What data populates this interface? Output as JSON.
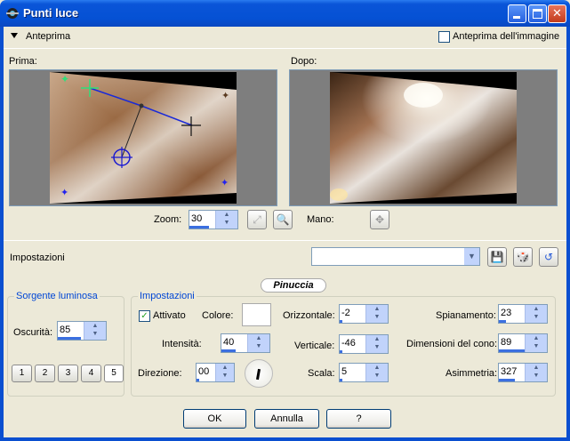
{
  "window": {
    "title": "Punti luce"
  },
  "preview": {
    "section_label": "Anteprima",
    "image_preview_label": "Anteprima dell'immagine",
    "before_label": "Prima:",
    "after_label": "Dopo:",
    "zoom_label": "Zoom:",
    "zoom_value": "30",
    "pan_label": "Mano:"
  },
  "presets": {
    "label": "Impostazioni",
    "selected": ""
  },
  "watermark": "Pinuccia",
  "light_source": {
    "group_title": "Sorgente luminosa",
    "darkness_label": "Oscurità:",
    "darkness_value": "85",
    "light_tabs": [
      "1",
      "2",
      "3",
      "4",
      "5"
    ]
  },
  "settings": {
    "group_title": "Impostazioni",
    "enabled_label": "Attivato",
    "enabled": true,
    "color_label": "Colore:",
    "color_value": "#FFFFFF",
    "intensity_label": "Intensità:",
    "intensity_value": "40",
    "direction_label": "Direzione:",
    "direction_value": "00",
    "horizontal_label": "Orizzontale:",
    "horizontal_value": "-2",
    "vertical_label": "Verticale:",
    "vertical_value": "-46",
    "scale_label": "Scala:",
    "scale_value": "5",
    "smoothing_label": "Spianamento:",
    "smoothing_value": "23",
    "cone_label": "Dimensioni del cono:",
    "cone_value": "89",
    "asymmetry_label": "Asimmetria:",
    "asymmetry_value": "327"
  },
  "buttons": {
    "ok": "OK",
    "cancel": "Annulla",
    "help": "?"
  },
  "colors": {
    "title_bar": "#0A55D8",
    "dialog_bg": "#ECE9D8",
    "group_title": "#0046D5",
    "spin_accent": "#3B6FE0"
  }
}
